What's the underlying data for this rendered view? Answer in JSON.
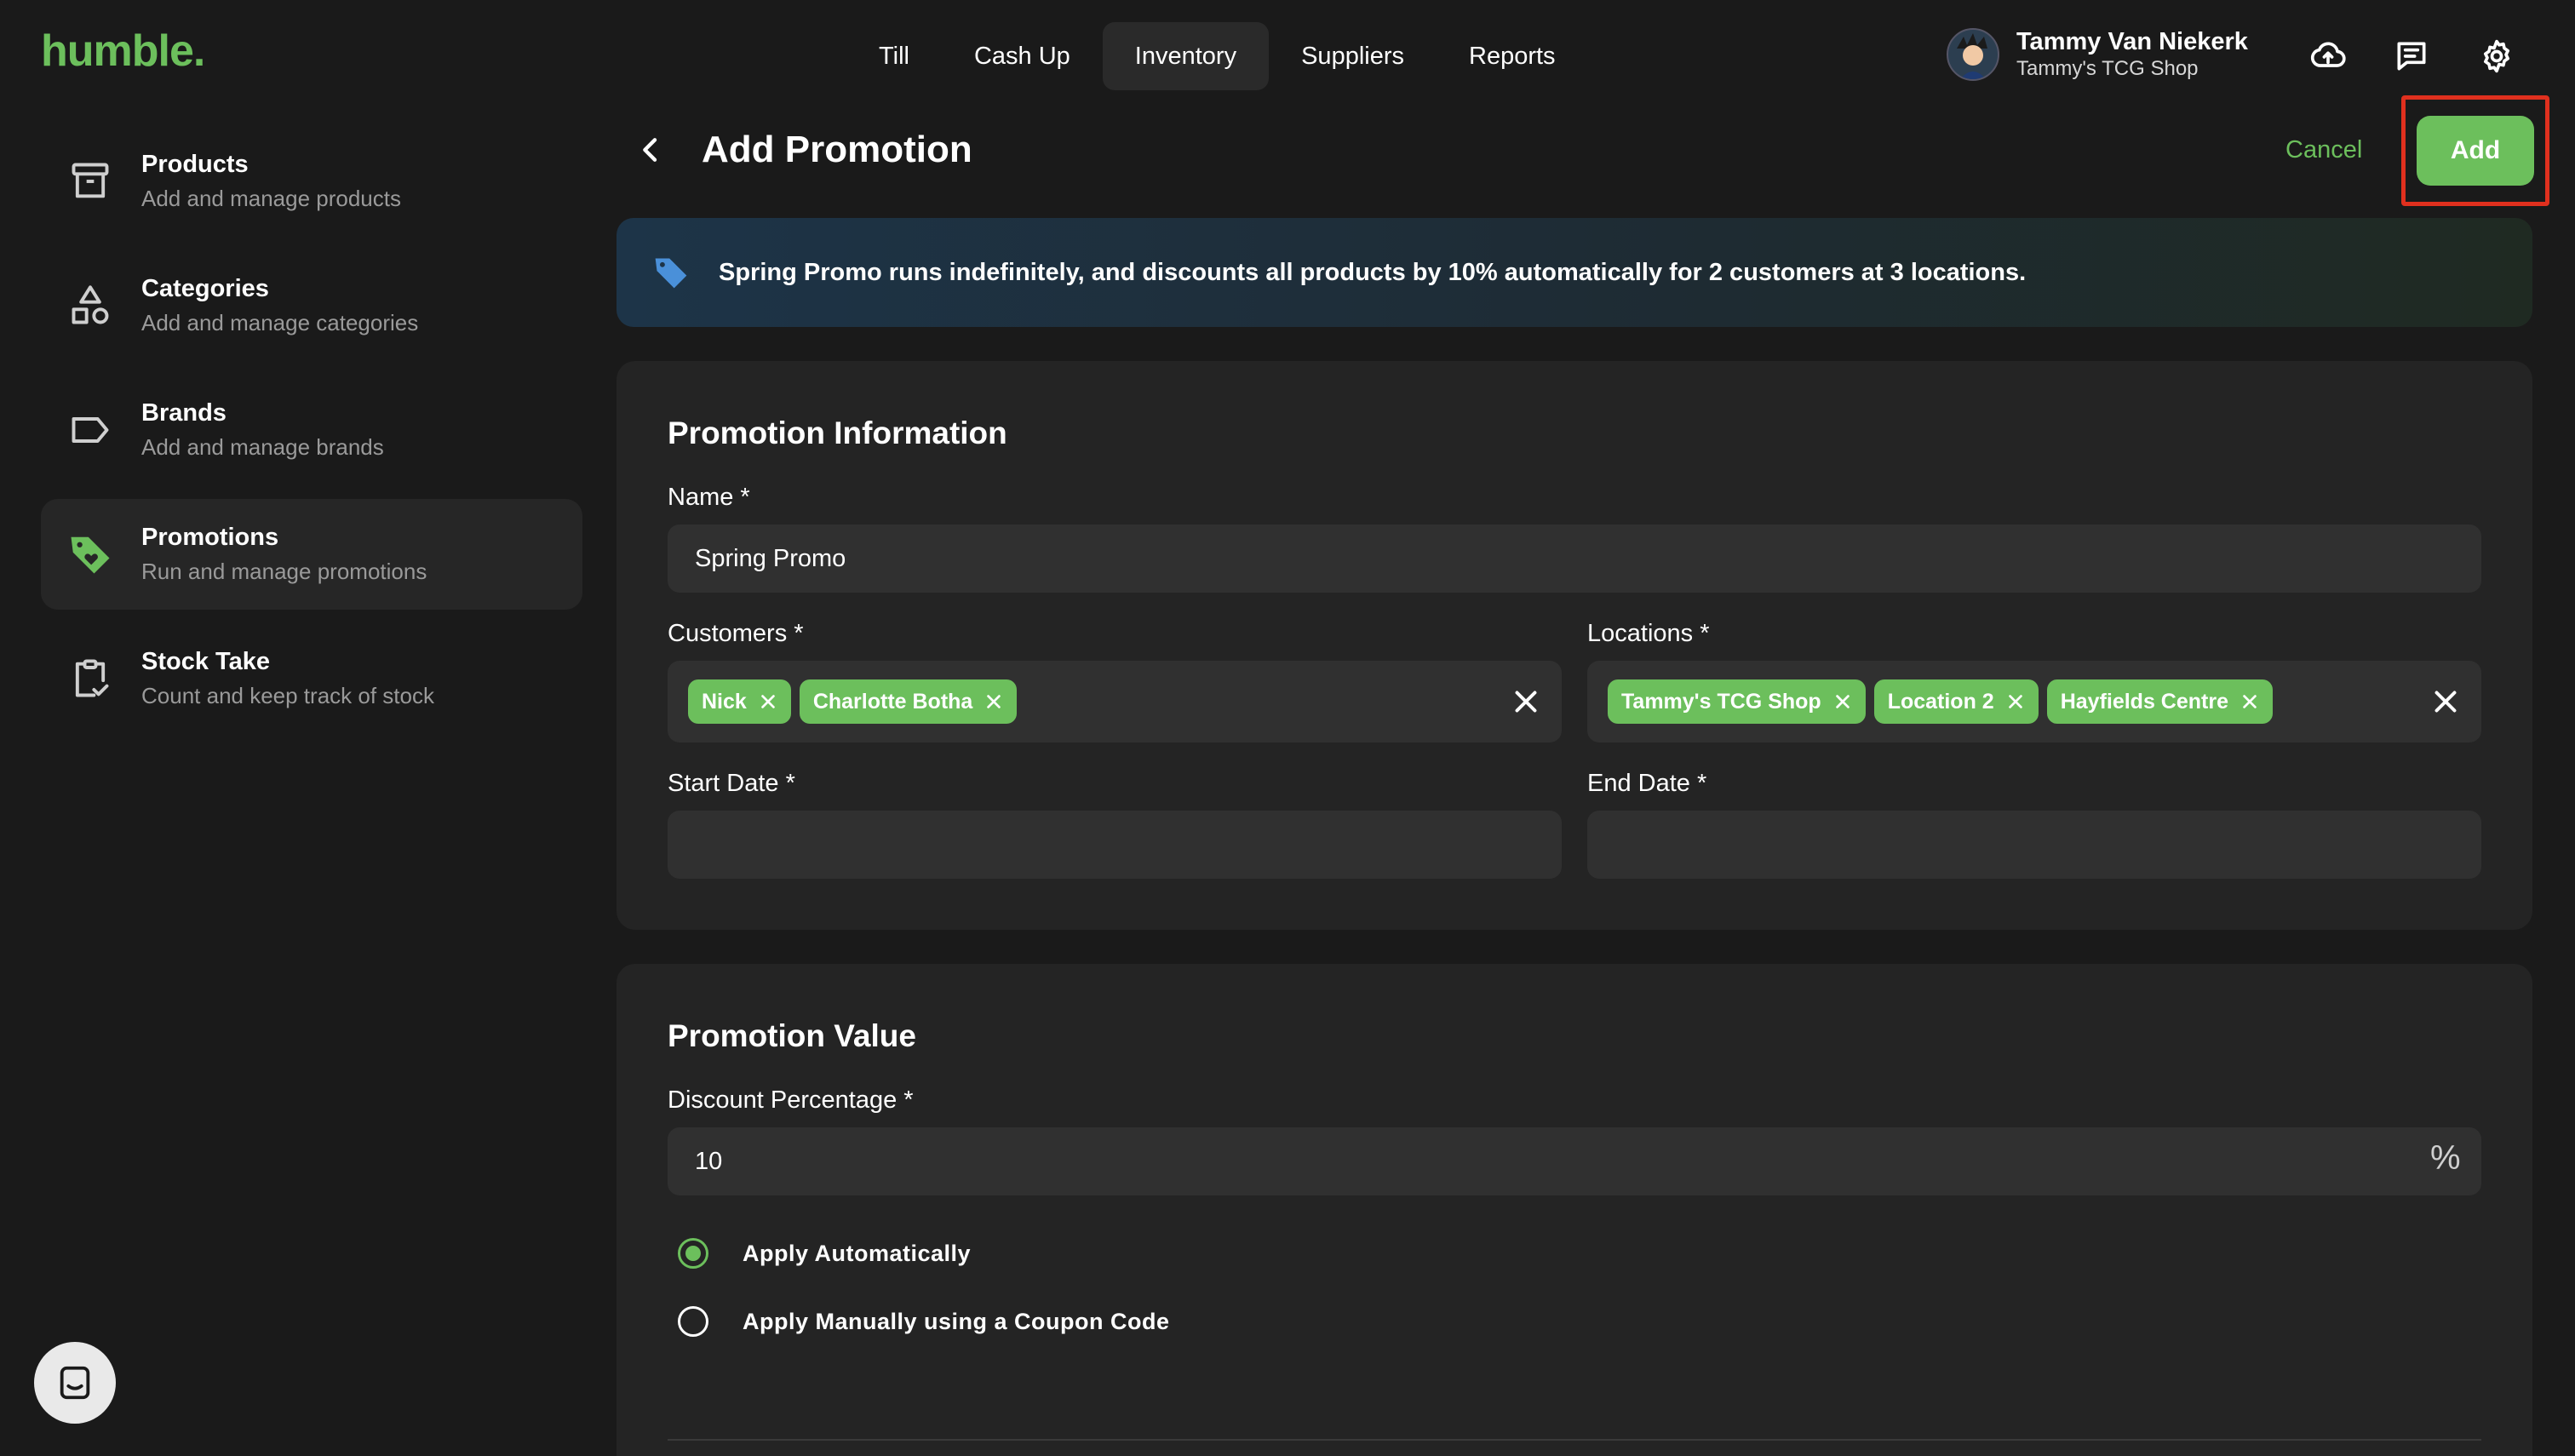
{
  "app": {
    "logo": "humble",
    "logo_dot": "."
  },
  "nav": {
    "items": [
      {
        "label": "Till"
      },
      {
        "label": "Cash Up"
      },
      {
        "label": "Inventory",
        "active": true
      },
      {
        "label": "Suppliers"
      },
      {
        "label": "Reports"
      }
    ]
  },
  "user": {
    "name": "Tammy Van Niekerk",
    "shop": "Tammy's TCG Shop"
  },
  "sidebar": {
    "items": [
      {
        "title": "Products",
        "subtitle": "Add and manage products",
        "icon": "archive-box-icon"
      },
      {
        "title": "Categories",
        "subtitle": "Add and manage categories",
        "icon": "shapes-icon"
      },
      {
        "title": "Brands",
        "subtitle": "Add and manage brands",
        "icon": "tag-outline-icon"
      },
      {
        "title": "Promotions",
        "subtitle": "Run and manage promotions",
        "icon": "tag-heart-icon",
        "active": true
      },
      {
        "title": "Stock Take",
        "subtitle": "Count and keep track of stock",
        "icon": "clipboard-check-icon"
      }
    ]
  },
  "header": {
    "title": "Add Promotion",
    "cancel_label": "Cancel",
    "add_label": "Add"
  },
  "banner": {
    "text": "Spring Promo runs indefinitely, and discounts all products by 10% automatically for 2 customers at 3 locations."
  },
  "promotion_info": {
    "title": "Promotion Information",
    "name_label": "Name *",
    "name_value": "Spring Promo",
    "customers_label": "Customers *",
    "customers": [
      "Nick",
      "Charlotte Botha"
    ],
    "locations_label": "Locations *",
    "locations": [
      "Tammy's TCG Shop",
      "Location 2",
      "Hayfields Centre"
    ],
    "start_date_label": "Start Date *",
    "start_date_value": "",
    "end_date_label": "End Date *",
    "end_date_value": ""
  },
  "promotion_value": {
    "title": "Promotion Value",
    "discount_label": "Discount Percentage *",
    "discount_value": "10",
    "percent_symbol": "%",
    "options": [
      {
        "label": "Apply Automatically",
        "checked": true
      },
      {
        "label": "Apply Manually using a Coupon Code",
        "checked": false
      }
    ]
  },
  "colors": {
    "accent": "#6cbf5c",
    "background": "#1a1a1a",
    "card": "#242424",
    "input": "#303030",
    "highlight": "#e0301e"
  }
}
